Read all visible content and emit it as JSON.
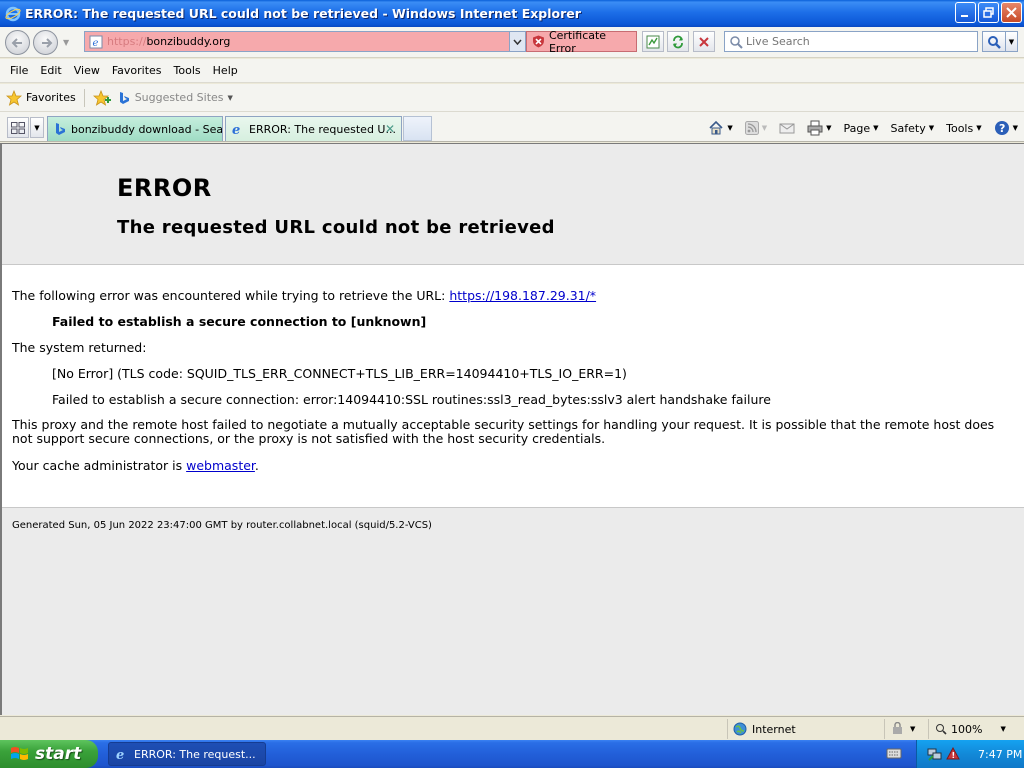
{
  "window": {
    "title": "ERROR: The requested URL could not be retrieved - Windows Internet Explorer"
  },
  "address_bar": {
    "url_scheme": "https://",
    "url_host": "bonzibuddy.org",
    "certificate_error_label": "Certificate Error",
    "search_placeholder": "Live Search"
  },
  "menu": {
    "items": [
      "File",
      "Edit",
      "View",
      "Favorites",
      "Tools",
      "Help"
    ]
  },
  "favorites_bar": {
    "favorites_label": "Favorites",
    "suggested_sites_label": "Suggested Sites"
  },
  "tabs": [
    {
      "label": "bonzibuddy download - Search",
      "active": false
    },
    {
      "label": "ERROR: The requested U...",
      "active": true
    }
  ],
  "command_bar": {
    "page_label": "Page",
    "safety_label": "Safety",
    "tools_label": "Tools"
  },
  "page": {
    "heading": "ERROR",
    "subheading": "The requested URL could not be retrieved",
    "intro_text": "The following error was encountered while trying to retrieve the URL: ",
    "intro_link": "https://198.187.29.31/*",
    "failure_text": "Failed to establish a secure connection to [unknown]",
    "system_returned": "The system returned:",
    "error_line_1": "[No Error] (TLS code: SQUID_TLS_ERR_CONNECT+TLS_LIB_ERR=14094410+TLS_IO_ERR=1)",
    "error_line_2": "Failed to establish a secure connection: error:14094410:SSL routines:ssl3_read_bytes:sslv3 alert handshake failure",
    "explanation": "This proxy and the remote host failed to negotiate a mutually acceptable security settings for handling your request. It is possible that the remote host does not support secure connections, or the proxy is not satisfied with the host security credentials.",
    "admin_text": "Your cache administrator is ",
    "admin_link": "webmaster",
    "admin_suffix": ".",
    "footer": "Generated Sun, 05 Jun 2022 23:47:00 GMT by router.collabnet.local (squid/5.2-VCS)"
  },
  "status_bar": {
    "zone": "Internet",
    "zoom": "100%"
  },
  "taskbar": {
    "start_label": "start",
    "task_item_label": "ERROR: The request...",
    "clock": "7:47 PM"
  },
  "colors": {
    "cert_error_bg": "#f6a9ac",
    "link": "#0000cc",
    "title_bar": "#0b56d6",
    "start_green": "#3aa23a"
  }
}
